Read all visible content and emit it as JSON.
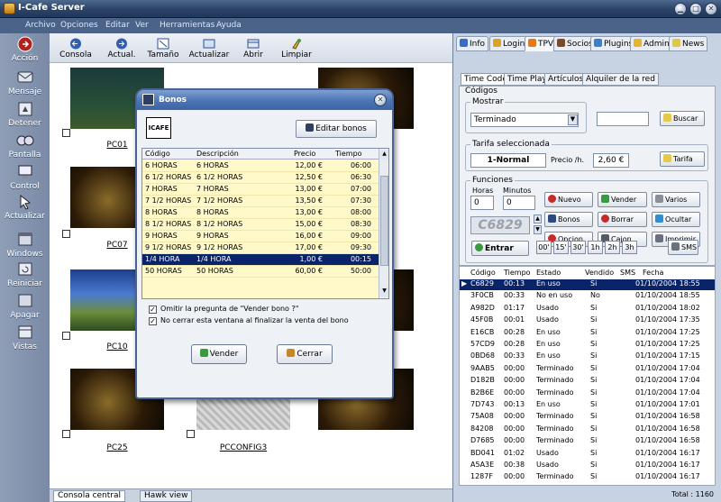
{
  "window": {
    "title": "I-Cafe Server",
    "min": "▁",
    "max": "□",
    "close": "✕"
  },
  "menu": [
    "Archivo",
    "Opciones",
    "Editar",
    "Ver",
    "Herramientas",
    "Ayuda"
  ],
  "sidebar": [
    {
      "label": "Acción",
      "icon": "action-icon"
    },
    {
      "label": "Mensaje",
      "icon": "message-icon"
    },
    {
      "label": "Detener",
      "icon": "stop-icon"
    },
    {
      "label": "Pantalla",
      "icon": "screen-icon"
    },
    {
      "label": "Control",
      "icon": "control-icon"
    },
    {
      "label": "Actualizar",
      "icon": "refresh-icon"
    },
    {
      "label": "Windows",
      "icon": "windows-icon"
    },
    {
      "label": "Reiniciar",
      "icon": "restart-icon"
    },
    {
      "label": "Apagar",
      "icon": "shutdown-icon"
    },
    {
      "label": "Vistas",
      "icon": "views-icon"
    }
  ],
  "toolbar": [
    {
      "label": "Consola",
      "icon": "console-icon"
    },
    {
      "label": "Actual.",
      "icon": "update-icon"
    },
    {
      "label": "Tamaño",
      "icon": "resize-icon"
    },
    {
      "label": "Actualizar",
      "icon": "refresh-icon"
    },
    {
      "label": "Abrir",
      "icon": "open-icon"
    },
    {
      "label": "Limpiar",
      "icon": "clean-icon"
    }
  ],
  "pcs": [
    {
      "name": "PC01"
    },
    {
      "name": "PC07"
    },
    {
      "name": "PC10"
    },
    {
      "name": "PC25"
    },
    {
      "name": "PCCONFIG3"
    }
  ],
  "bottom_tabs": [
    "Consola central",
    "Hawk view"
  ],
  "right_tabs": [
    "Info",
    "Login",
    "TPV",
    "Socios",
    "Plugins",
    "Admin",
    "News"
  ],
  "sub_tabs": [
    "Time Code",
    "Time Play",
    "Artículos",
    "Alquiler de la red"
  ],
  "tpv": {
    "codigos": "Códigos",
    "mostrar": "Mostrar",
    "mostrar_value": "Terminado",
    "buscar": "Buscar",
    "tarifa_sel": "Tarifa seleccionada",
    "tarifa_value": "1-Normal",
    "precio_label": "Precio /h.",
    "precio_value": "2,60 €",
    "tarifa_btn": "Tarifa",
    "funciones": "Funciones",
    "horas": "Horas",
    "minutos": "Minutos",
    "horas_val": "0",
    "minutos_val": "0",
    "code": "C6829",
    "buttons": [
      "Nuevo",
      "Vender",
      "Varios",
      "Bonos",
      "Borrar",
      "Ocultar",
      "Opcion",
      "Cajon",
      "Imprimir"
    ],
    "entrar": "Entrar",
    "times": [
      "00'",
      "15'",
      "30'",
      "1h",
      "2h",
      "3h"
    ],
    "sms": "SMS"
  },
  "codes_header": [
    "Código",
    "Tiempo",
    "Estado",
    "Vendido",
    "SMS",
    "Fecha"
  ],
  "codes": [
    [
      "C6829",
      "00:13",
      "En uso",
      "Si",
      "",
      "01/10/2004 18:55"
    ],
    [
      "3F0CB",
      "00:33",
      "No en uso",
      "No",
      "",
      "01/10/2004 18:55"
    ],
    [
      "A982D",
      "01:17",
      "Usado",
      "Si",
      "",
      "01/10/2004 18:02"
    ],
    [
      "45F0B",
      "00:01",
      "Usado",
      "Si",
      "",
      "01/10/2004 17:35"
    ],
    [
      "E16CB",
      "00:28",
      "En uso",
      "Si",
      "",
      "01/10/2004 17:25"
    ],
    [
      "57CD9",
      "00:28",
      "En uso",
      "Si",
      "",
      "01/10/2004 17:25"
    ],
    [
      "0BD68",
      "00:33",
      "En uso",
      "Si",
      "",
      "01/10/2004 17:15"
    ],
    [
      "9AAB5",
      "00:00",
      "Terminado",
      "Si",
      "",
      "01/10/2004 17:04"
    ],
    [
      "D182B",
      "00:00",
      "Terminado",
      "Si",
      "",
      "01/10/2004 17:04"
    ],
    [
      "B2B6E",
      "00:00",
      "Terminado",
      "Si",
      "",
      "01/10/2004 17:04"
    ],
    [
      "7D743",
      "00:13",
      "En uso",
      "Si",
      "",
      "01/10/2004 17:01"
    ],
    [
      "75A08",
      "00:00",
      "Terminado",
      "Si",
      "",
      "01/10/2004 16:58"
    ],
    [
      "84208",
      "00:00",
      "Terminado",
      "Si",
      "",
      "01/10/2004 16:58"
    ],
    [
      "D7685",
      "00:00",
      "Terminado",
      "Si",
      "",
      "01/10/2004 16:58"
    ],
    [
      "BD041",
      "01:02",
      "Usado",
      "Si",
      "",
      "01/10/2004 16:17"
    ],
    [
      "A5A3E",
      "00:38",
      "Usado",
      "Si",
      "",
      "01/10/2004 16:17"
    ],
    [
      "1287F",
      "00:00",
      "Terminado",
      "Si",
      "",
      "01/10/2004 16:17"
    ]
  ],
  "total": "Total : 1160",
  "dialog": {
    "title": "Bonos",
    "logo_text": "ICAFE",
    "edit_btn": "Editar bonos",
    "header": [
      "Código",
      "Descripción",
      "Precio",
      "Tiempo"
    ],
    "rows": [
      [
        "6 HORAS",
        "6 HORAS",
        "12,00 €",
        "06:00"
      ],
      [
        "6 1/2 HORAS",
        "6 1/2 HORAS",
        "12,50 €",
        "06:30"
      ],
      [
        "7 HORAS",
        "7 HORAS",
        "13,00 €",
        "07:00"
      ],
      [
        "7 1/2 HORAS",
        "7 1/2 HORAS",
        "13,50 €",
        "07:30"
      ],
      [
        "8 HORAS",
        "8 HORAS",
        "13,00 €",
        "08:00"
      ],
      [
        "8 1/2 HORAS",
        "8 1/2 HORAS",
        "15,00 €",
        "08:30"
      ],
      [
        "9 HORAS",
        "9 HORAS",
        "16,00 €",
        "09:00"
      ],
      [
        "9 1/2 HORAS",
        "9 1/2 HORAS",
        "17,00 €",
        "09:30"
      ],
      [
        "1/4 HORA",
        "1/4 HORA",
        "1,00 €",
        "00:15"
      ],
      [
        "50 HORAS",
        "50 HORAS",
        "60,00 €",
        "50:00"
      ]
    ],
    "selected_row": 8,
    "opt1": "Omitir la pregunta de \"Vender bono ?\"",
    "opt2": "No cerrar esta ventana al finalizar la venta del bono",
    "vender": "Vender",
    "cerrar": "Cerrar"
  },
  "colors": {
    "accent": "#0a246a",
    "title": "#2c4569",
    "panel": "#c7d2e2",
    "table": "#fff8c8"
  }
}
